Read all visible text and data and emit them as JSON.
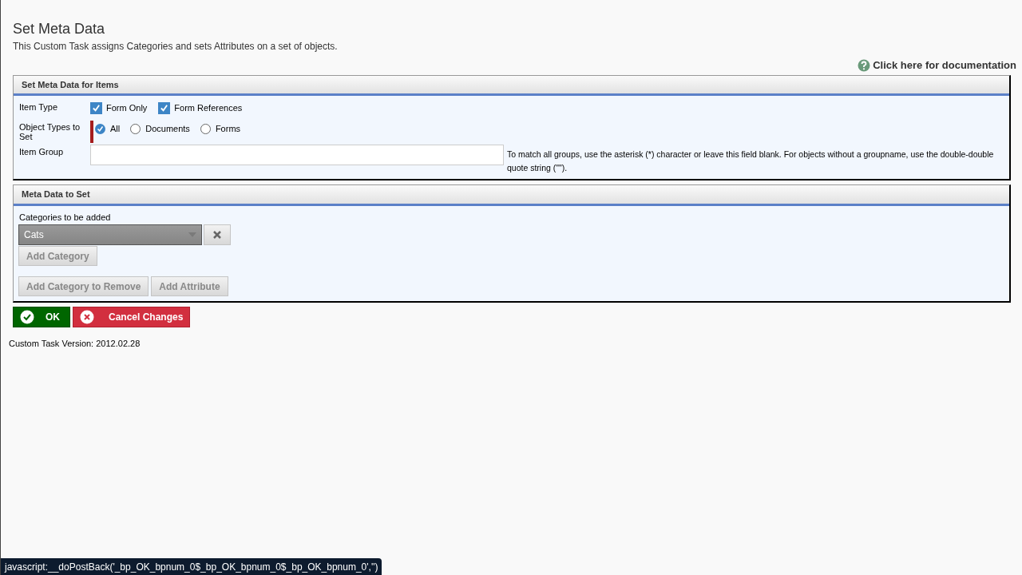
{
  "header": {
    "title": "Set Meta Data",
    "subtitle": "This Custom Task assigns Categories and sets Attributes on a set of objects.",
    "doc_link": "Click here for documentation"
  },
  "items_panel": {
    "title": "Set Meta Data for Items",
    "item_type": {
      "label": "Item Type",
      "options": [
        {
          "label": "Form Only",
          "checked": true
        },
        {
          "label": "Form References",
          "checked": true
        }
      ]
    },
    "object_types": {
      "label": "Object Types to Set",
      "options": [
        {
          "label": "All",
          "selected": true
        },
        {
          "label": "Documents",
          "selected": false
        },
        {
          "label": "Forms",
          "selected": false
        }
      ]
    },
    "item_group": {
      "label": "Item Group",
      "hint": "To match all groups, use the asterisk (*) character or leave this field blank. For objects without a groupname, use the double-double quote string (\"\")."
    }
  },
  "meta_panel": {
    "title": "Meta Data to Set",
    "categories_label": "Categories to be added",
    "category_select": "Cats",
    "add_category": "Add Category",
    "buttons": [
      "Add Category to Remove",
      "Add Attribute"
    ]
  },
  "actions": {
    "ok": "OK",
    "cancel": "Cancel Changes"
  },
  "version": "Custom Task Version: 2012.02.28",
  "status_bar": "javascript:__doPostBack('_bp_OK_bpnum_0$_bp_OK_bpnum_0$_bp_OK_bpnum_0','')"
}
